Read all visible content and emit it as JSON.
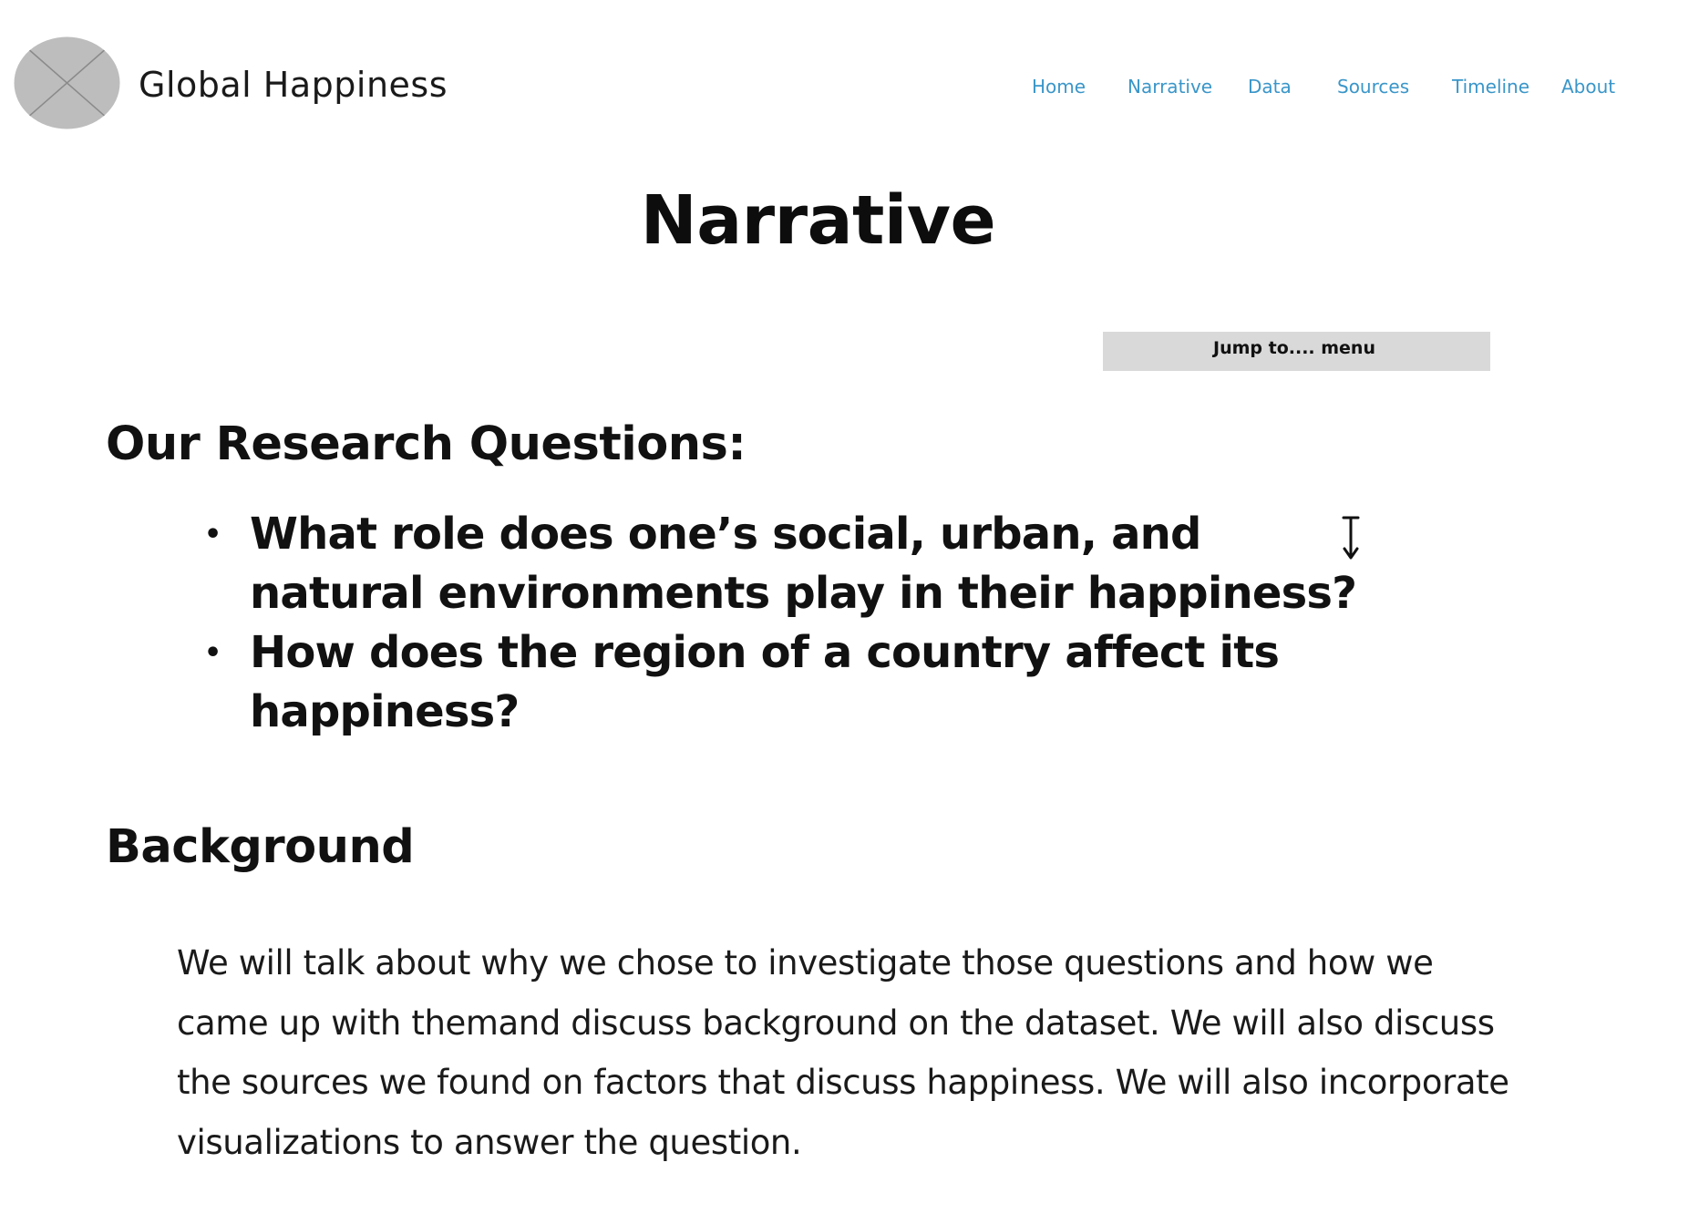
{
  "header": {
    "site_title": "Global Happiness",
    "logo_icon": "image-placeholder-icon"
  },
  "nav": {
    "items": [
      {
        "label": "Home"
      },
      {
        "label": "Narrative"
      },
      {
        "label": "Data"
      },
      {
        "label": "Sources"
      },
      {
        "label": "Timeline"
      },
      {
        "label": "About"
      }
    ],
    "link_color": "#3a96c9"
  },
  "main": {
    "page_title": "Narrative",
    "jump_menu": {
      "label": "Jump to.... menu",
      "background_color": "#d9d9d9"
    },
    "research": {
      "heading": "Our Research Questions:",
      "questions": [
        "What role does one’s social, urban, and natural environments play in their happiness?",
        "How does the region of a country affect its happiness?"
      ]
    },
    "background": {
      "heading": "Background",
      "text": "We will talk about why we chose to investigate those questions and how we came up with themand discuss background on the dataset. We will also discuss the sources we found on factors that discuss happiness. We will also incorporate visualizations to answer the question."
    }
  }
}
